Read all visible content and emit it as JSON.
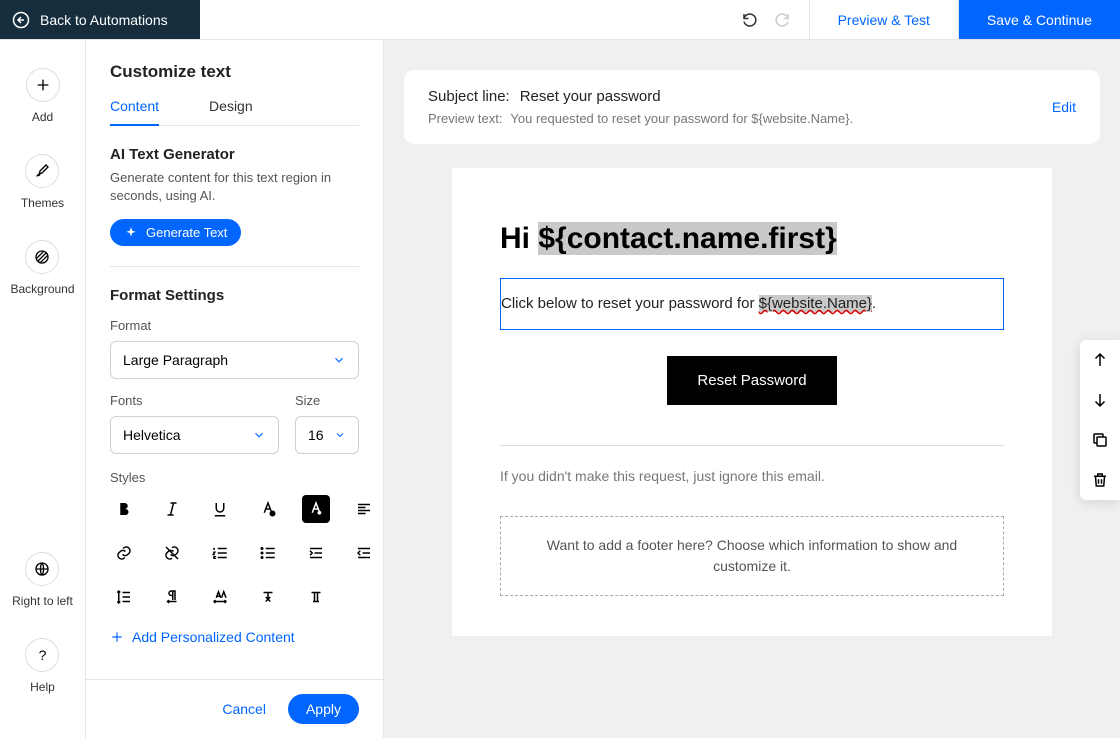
{
  "topbar": {
    "back_label": "Back to Automations",
    "preview_label": "Preview & Test",
    "save_label": "Save & Continue"
  },
  "rail": {
    "add": "Add",
    "themes": "Themes",
    "background": "Background",
    "rtl": "Right to left",
    "help": "Help"
  },
  "panel": {
    "title": "Customize text",
    "tabs": {
      "content": "Content",
      "design": "Design"
    },
    "ai": {
      "heading": "AI Text Generator",
      "desc": "Generate content for this text region in seconds, using AI.",
      "button": "Generate Text"
    },
    "format": {
      "heading": "Format Settings",
      "format_label": "Format",
      "format_value": "Large Paragraph",
      "fonts_label": "Fonts",
      "fonts_value": "Helvetica",
      "size_label": "Size",
      "size_value": "16",
      "styles_label": "Styles"
    },
    "personal": "Add Personalized Content",
    "footer": {
      "cancel": "Cancel",
      "apply": "Apply"
    }
  },
  "subject": {
    "subject_label": "Subject line:",
    "subject_value": "Reset your password",
    "preview_label": "Preview text:",
    "preview_value": "You requested to reset your password for ${website.Name}.",
    "edit": "Edit"
  },
  "email": {
    "greeting_prefix": "Hi ",
    "greeting_var": "${contact.name.first}",
    "body_prefix": "Click below to reset your password for ",
    "body_var": "${website.Name}",
    "body_suffix": ".",
    "button": "Reset Password",
    "ignore": "If you didn't make this request, just ignore this email.",
    "footer_placeholder": "Want to add a footer here? Choose which information to show and customize it."
  }
}
